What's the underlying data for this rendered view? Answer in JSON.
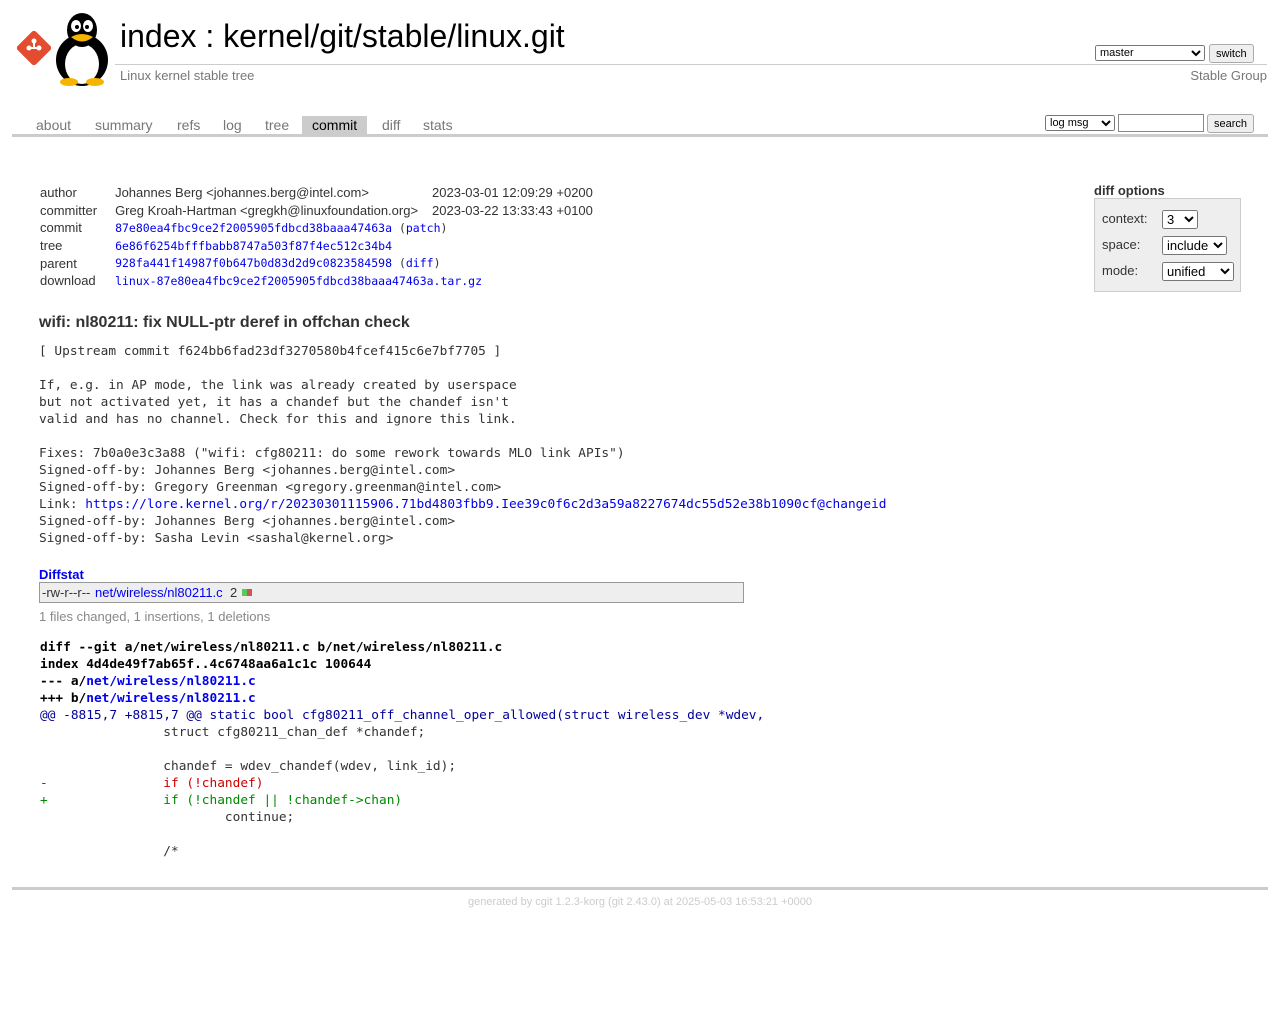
{
  "header": {
    "title_index": "index",
    "title_sep": " : ",
    "title_repo": "kernel/git/stable/linux.git",
    "description": "Linux kernel stable tree",
    "owner": "Stable Group",
    "branch_selected": "master",
    "switch_label": "switch"
  },
  "tabs": [
    {
      "label": "about"
    },
    {
      "label": "summary"
    },
    {
      "label": "refs"
    },
    {
      "label": "log"
    },
    {
      "label": "tree"
    },
    {
      "label": "commit",
      "active": true
    },
    {
      "label": "diff"
    },
    {
      "label": "stats"
    }
  ],
  "search": {
    "scope_selected": "log msg",
    "query": "",
    "button_label": "search"
  },
  "diff_options": {
    "title": "diff options",
    "context_label": "context:",
    "context_value": "3",
    "space_label": "space:",
    "space_value": "include",
    "mode_label": "mode:",
    "mode_value": "unified"
  },
  "commit_info": {
    "author_label": "author",
    "author": "Johannes Berg <johannes.berg@intel.com>",
    "author_date": "2023-03-01 12:09:29 +0200",
    "committer_label": "committer",
    "committer": "Greg Kroah-Hartman <gregkh@linuxfoundation.org>",
    "committer_date": "2023-03-22 13:33:43 +0100",
    "commit_label": "commit",
    "commit_sha": "87e80ea4fbc9ce2f2005905fdbcd38baaa47463a",
    "patch_link": "patch",
    "tree_label": "tree",
    "tree_sha": "6e86f6254bfffbabb8747a503f87f4ec512c34b4",
    "parent_label": "parent",
    "parent_sha": "928fa441f14987f0b647b0d83d2d9c0823584598",
    "diff_link": "diff",
    "download_label": "download",
    "download_file": "linux-87e80ea4fbc9ce2f2005905fdbcd38baaa47463a.tar.gz"
  },
  "commit": {
    "subject": "wifi: nl80211: fix NULL-ptr deref in offchan check",
    "message": [
      {
        "text": "[ Upstream commit f624bb6fad23df3270580b4fcef415c6e7bf7705 ]"
      },
      {
        "text": ""
      },
      {
        "text": "If, e.g. in AP mode, the link was already created by userspace"
      },
      {
        "text": "but not activated yet, it has a chandef but the chandef isn't"
      },
      {
        "text": "valid and has no channel. Check for this and ignore this link."
      },
      {
        "text": ""
      },
      {
        "text": "Fixes: 7b0a0e3c3a88 (\"wifi: cfg80211: do some rework towards MLO link APIs\")"
      },
      {
        "text": "Signed-off-by: Johannes Berg <johannes.berg@intel.com>"
      },
      {
        "text": "Signed-off-by: Gregory Greenman <gregory.greenman@intel.com>"
      },
      {
        "text": "Link: ",
        "link": "https://lore.kernel.org/r/20230301115906.71bd4803fbb9.Iee39c0f6c2d3a59a8227674dc55d52e38b1090cf@changeid"
      },
      {
        "text": "Signed-off-by: Johannes Berg <johannes.berg@intel.com>"
      },
      {
        "text": "Signed-off-by: Sasha Levin <sashal@kernel.org>"
      }
    ]
  },
  "diffstat": {
    "header": "Diffstat",
    "mode": "-rw-r--r--",
    "file": "net/wireless/nl80211.c",
    "changes": "2",
    "added": 1,
    "deleted": 1,
    "summary": "1 files changed, 1 insertions, 1 deletions",
    "colors": {
      "add": "#55cc55",
      "del": "#cc5555"
    }
  },
  "diff": {
    "lines": [
      {
        "type": "head",
        "text": "diff --git a/net/wireless/nl80211.c b/net/wireless/nl80211.c"
      },
      {
        "type": "head",
        "text": "index 4d4de49f7ab65f..4c6748aa6a1c1c 100644"
      },
      {
        "type": "head",
        "text": "--- a/",
        "link": "net/wireless/nl80211.c"
      },
      {
        "type": "head",
        "text": "+++ b/",
        "link": "net/wireless/nl80211.c"
      },
      {
        "type": "hunk",
        "text": "@@ -8815,7 +8815,7 @@ static bool cfg80211_off_channel_oper_allowed(struct wireless_dev *wdev,"
      },
      {
        "type": "ctx",
        "text": " \t\tstruct cfg80211_chan_def *chandef;"
      },
      {
        "type": "ctx",
        "text": " "
      },
      {
        "type": "ctx",
        "text": " \t\tchandef = wdev_chandef(wdev, link_id);"
      },
      {
        "type": "del",
        "text": "-\t\tif (!chandef)"
      },
      {
        "type": "add",
        "text": "+\t\tif (!chandef || !chandef->chan)"
      },
      {
        "type": "ctx",
        "text": " \t\t\tcontinue;"
      },
      {
        "type": "ctx",
        "text": " "
      },
      {
        "type": "ctx",
        "text": " \t\t/*"
      }
    ]
  },
  "footer": "generated by cgit 1.2.3-korg (git 2.43.0) at 2025-05-03 16:53:21 +0000"
}
